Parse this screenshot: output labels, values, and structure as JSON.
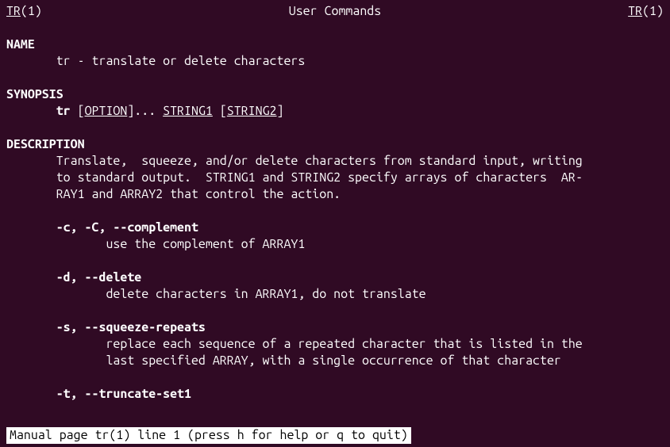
{
  "header": {
    "left_cmd": "TR",
    "left_sec": "(1)",
    "center": "User Commands",
    "right_cmd": "TR",
    "right_sec": "(1)"
  },
  "sections": {
    "name_heading": "NAME",
    "name_line": "tr - translate or delete characters",
    "synopsis_heading": "SYNOPSIS",
    "synopsis": {
      "cmd": "tr",
      "open_bracket": " [",
      "option": "OPTION",
      "close_bracket_dots": "]... ",
      "string1": "STRING1",
      "space_open": " [",
      "string2": "STRING2",
      "close": "]"
    },
    "description_heading": "DESCRIPTION",
    "description_lines": [
      "Translate,  squeeze, and/or delete characters from standard input, writing",
      "to standard output.  STRING1 and STRING2 specify arrays of characters  AR‐",
      "RAY1 and ARRAY2 that control the action."
    ],
    "opt_c_flags": "-c, -C, --complement",
    "opt_c_desc": "use the complement of ARRAY1",
    "opt_d_flags": "-d, --delete",
    "opt_d_desc": "delete characters in ARRAY1, do not translate",
    "opt_s_flags": "-s, --squeeze-repeats",
    "opt_s_desc1": "replace each sequence of a repeated character that is listed in the",
    "opt_s_desc2": "last specified ARRAY, with a single occurrence of that character",
    "opt_t_flags": "-t, --truncate-set1"
  },
  "status": "Manual page tr(1) line 1 (press h for help or q to quit)"
}
